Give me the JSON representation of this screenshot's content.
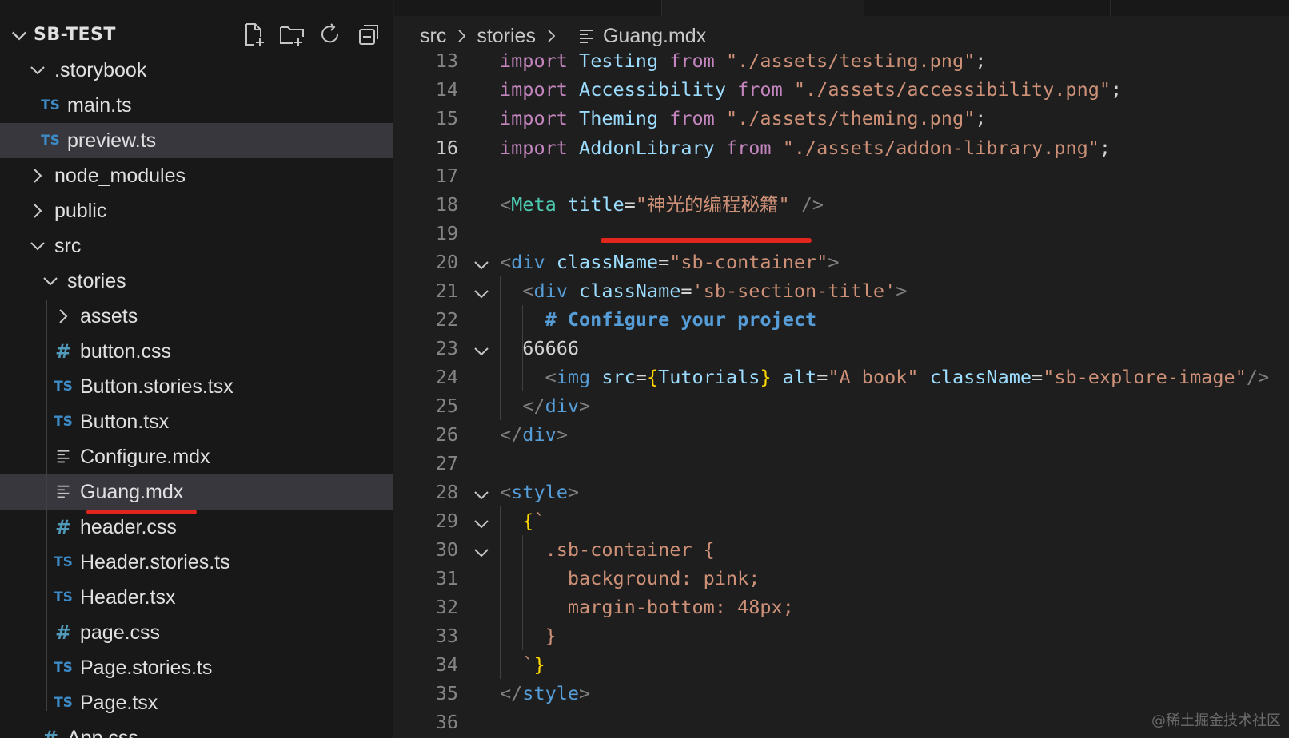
{
  "explorer": {
    "title": "SB-TEST",
    "actions": [
      "new-file-icon",
      "new-folder-icon",
      "refresh-icon",
      "collapse-all-icon"
    ],
    "items": [
      {
        "label": ".storybook",
        "kind": "folder",
        "expanded": true,
        "depth": 1
      },
      {
        "label": "main.ts",
        "kind": "ts",
        "depth": 2
      },
      {
        "label": "preview.ts",
        "kind": "ts",
        "depth": 2,
        "selected": true
      },
      {
        "label": "node_modules",
        "kind": "folder",
        "expanded": false,
        "depth": 1
      },
      {
        "label": "public",
        "kind": "folder",
        "expanded": false,
        "depth": 1
      },
      {
        "label": "src",
        "kind": "folder",
        "expanded": true,
        "depth": 1
      },
      {
        "label": "stories",
        "kind": "folder",
        "expanded": true,
        "depth": 2
      },
      {
        "label": "assets",
        "kind": "folder",
        "expanded": false,
        "depth": 3
      },
      {
        "label": "button.css",
        "kind": "css",
        "depth": 3
      },
      {
        "label": "Button.stories.tsx",
        "kind": "ts",
        "depth": 3
      },
      {
        "label": "Button.tsx",
        "kind": "ts",
        "depth": 3
      },
      {
        "label": "Configure.mdx",
        "kind": "mdx",
        "depth": 3
      },
      {
        "label": "Guang.mdx",
        "kind": "mdx",
        "depth": 3,
        "selected": true
      },
      {
        "label": "header.css",
        "kind": "css",
        "depth": 3
      },
      {
        "label": "Header.stories.ts",
        "kind": "ts",
        "depth": 3
      },
      {
        "label": "Header.tsx",
        "kind": "ts",
        "depth": 3
      },
      {
        "label": "page.css",
        "kind": "css",
        "depth": 3
      },
      {
        "label": "Page.stories.ts",
        "kind": "ts",
        "depth": 3
      },
      {
        "label": "Page.tsx",
        "kind": "ts",
        "depth": 3
      },
      {
        "label": "App.css",
        "kind": "css",
        "depth": 2
      }
    ],
    "icon_text": {
      "ts": "TS",
      "css": "#"
    }
  },
  "breadcrumb": {
    "parts": [
      "src",
      "stories",
      "Guang.mdx"
    ]
  },
  "editor": {
    "active_line": 16,
    "lines": [
      {
        "n": 13,
        "fold": false,
        "segs": [
          [
            "kw",
            "import "
          ],
          [
            "id",
            "Testing "
          ],
          [
            "kw",
            "from "
          ],
          [
            "str",
            "\"./assets/testing.png\""
          ],
          [
            "plain",
            ";"
          ]
        ]
      },
      {
        "n": 14,
        "fold": false,
        "segs": [
          [
            "kw",
            "import "
          ],
          [
            "id",
            "Accessibility "
          ],
          [
            "kw",
            "from "
          ],
          [
            "str",
            "\"./assets/accessibility.png\""
          ],
          [
            "plain",
            ";"
          ]
        ]
      },
      {
        "n": 15,
        "fold": false,
        "segs": [
          [
            "kw",
            "import "
          ],
          [
            "id",
            "Theming "
          ],
          [
            "kw",
            "from "
          ],
          [
            "str",
            "\"./assets/theming.png\""
          ],
          [
            "plain",
            ";"
          ]
        ]
      },
      {
        "n": 16,
        "fold": false,
        "segs": [
          [
            "kw",
            "import "
          ],
          [
            "id",
            "AddonLibrary "
          ],
          [
            "kw",
            "from "
          ],
          [
            "str",
            "\"./assets/addon-library.png\""
          ],
          [
            "plain",
            ";"
          ]
        ]
      },
      {
        "n": 17,
        "fold": false,
        "segs": []
      },
      {
        "n": 18,
        "fold": false,
        "segs": [
          [
            "punc",
            "<"
          ],
          [
            "comp",
            "Meta "
          ],
          [
            "id",
            "title"
          ],
          [
            "plain",
            "="
          ],
          [
            "str",
            "\"神光的编程秘籍\""
          ],
          [
            "punc",
            " />"
          ]
        ]
      },
      {
        "n": 19,
        "fold": false,
        "segs": []
      },
      {
        "n": 20,
        "fold": true,
        "segs": [
          [
            "punc",
            "<"
          ],
          [
            "tag",
            "div "
          ],
          [
            "id",
            "className"
          ],
          [
            "plain",
            "="
          ],
          [
            "str",
            "\"sb-container\""
          ],
          [
            "punc",
            ">"
          ]
        ]
      },
      {
        "n": 21,
        "fold": true,
        "segs": [
          [
            "plain",
            "  "
          ],
          [
            "punc",
            "<"
          ],
          [
            "tag",
            "div "
          ],
          [
            "id",
            "className"
          ],
          [
            "plain",
            "="
          ],
          [
            "str",
            "'sb-section-title'"
          ],
          [
            "punc",
            ">"
          ]
        ]
      },
      {
        "n": 22,
        "fold": false,
        "segs": [
          [
            "plain",
            "    "
          ],
          [
            "md",
            "# Configure your project"
          ]
        ]
      },
      {
        "n": 23,
        "fold": true,
        "segs": [
          [
            "plain",
            "  66666"
          ]
        ]
      },
      {
        "n": 24,
        "fold": false,
        "segs": [
          [
            "plain",
            "    "
          ],
          [
            "punc",
            "<"
          ],
          [
            "tag",
            "img "
          ],
          [
            "id",
            "src"
          ],
          [
            "plain",
            "="
          ],
          [
            "brace",
            "{"
          ],
          [
            "id",
            "Tutorials"
          ],
          [
            "brace",
            "}"
          ],
          [
            "id",
            " alt"
          ],
          [
            "plain",
            "="
          ],
          [
            "str",
            "\"A book\""
          ],
          [
            "id",
            " className"
          ],
          [
            "plain",
            "="
          ],
          [
            "str",
            "\"sb-explore-image\""
          ],
          [
            "punc",
            "/>"
          ]
        ]
      },
      {
        "n": 25,
        "fold": false,
        "segs": [
          [
            "plain",
            "  "
          ],
          [
            "punc",
            "</"
          ],
          [
            "tag",
            "div"
          ],
          [
            "punc",
            ">"
          ]
        ]
      },
      {
        "n": 26,
        "fold": false,
        "segs": [
          [
            "punc",
            "</"
          ],
          [
            "tag",
            "div"
          ],
          [
            "punc",
            ">"
          ]
        ]
      },
      {
        "n": 27,
        "fold": false,
        "segs": []
      },
      {
        "n": 28,
        "fold": true,
        "segs": [
          [
            "punc",
            "<"
          ],
          [
            "tag",
            "style"
          ],
          [
            "punc",
            ">"
          ]
        ]
      },
      {
        "n": 29,
        "fold": true,
        "segs": [
          [
            "plain",
            "  "
          ],
          [
            "brace",
            "{"
          ],
          [
            "str",
            "`"
          ]
        ]
      },
      {
        "n": 30,
        "fold": true,
        "segs": [
          [
            "plain",
            "    "
          ],
          [
            "str",
            ".sb-container {"
          ]
        ]
      },
      {
        "n": 31,
        "fold": false,
        "segs": [
          [
            "plain",
            "      "
          ],
          [
            "str",
            "background: pink;"
          ]
        ]
      },
      {
        "n": 32,
        "fold": false,
        "segs": [
          [
            "plain",
            "      "
          ],
          [
            "str",
            "margin-bottom: 48px;"
          ]
        ]
      },
      {
        "n": 33,
        "fold": false,
        "segs": [
          [
            "plain",
            "    "
          ],
          [
            "str",
            "}"
          ]
        ]
      },
      {
        "n": 34,
        "fold": false,
        "segs": [
          [
            "plain",
            "  "
          ],
          [
            "str",
            "`"
          ],
          [
            "brace",
            "}"
          ]
        ]
      },
      {
        "n": 35,
        "fold": false,
        "segs": [
          [
            "punc",
            "</"
          ],
          [
            "tag",
            "style"
          ],
          [
            "punc",
            ">"
          ]
        ]
      },
      {
        "n": 36,
        "fold": false,
        "segs": []
      }
    ]
  },
  "watermark": "@稀土掘金技术社区",
  "colors": {
    "sidebar_bg": "#181818",
    "editor_bg": "#1e1e1e",
    "selection_bg": "#37373d",
    "annotation_red": "#e0261d",
    "ts_icon": "#3c8ac6",
    "css_icon": "#519aba"
  }
}
